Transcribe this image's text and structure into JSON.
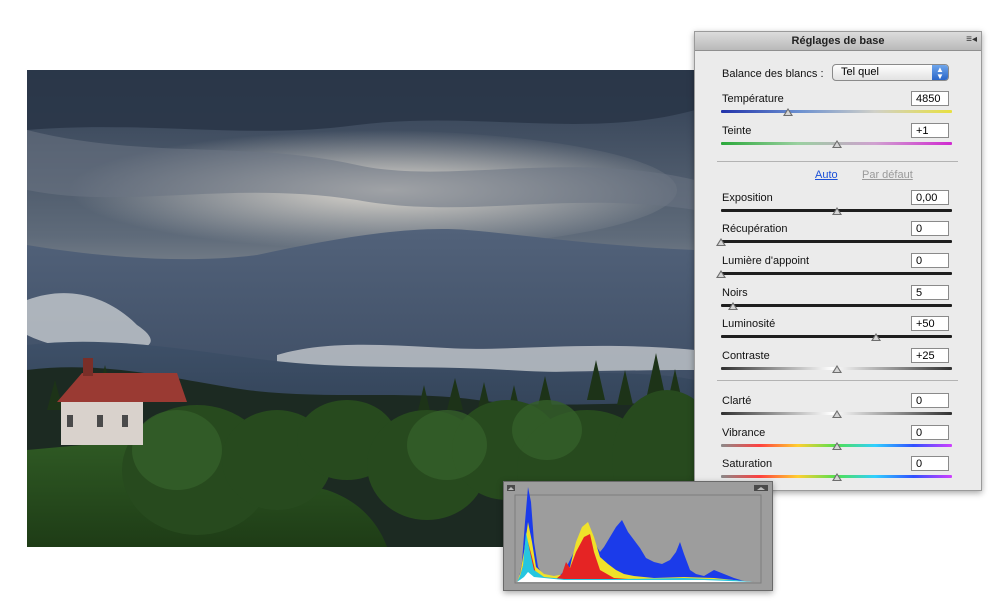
{
  "panel": {
    "title": "Réglages de base",
    "menu_icon": "menu-icon",
    "white_balance": {
      "label": "Balance des blancs :",
      "value": "Tel quel",
      "options": [
        "Tel quel"
      ]
    },
    "auto_label": "Auto",
    "default_label": "Par défaut",
    "sliders": [
      {
        "name": "temperature",
        "label": "Température",
        "value": "4850",
        "position": 0.29,
        "track": "temperature"
      },
      {
        "name": "tint",
        "label": "Teinte",
        "value": "+1",
        "position": 0.5,
        "track": "tint"
      },
      {
        "name": "exposure",
        "label": "Exposition",
        "value": "0,00",
        "position": 0.5,
        "track": "dark"
      },
      {
        "name": "recovery",
        "label": "Récupération",
        "value": "0",
        "position": 0.0,
        "track": "dark"
      },
      {
        "name": "fill-light",
        "label": "Lumière d'appoint",
        "value": "0",
        "position": 0.0,
        "track": "dark"
      },
      {
        "name": "blacks",
        "label": "Noirs",
        "value": "5",
        "position": 0.05,
        "track": "dark"
      },
      {
        "name": "brightness",
        "label": "Luminosité",
        "value": "+50",
        "position": 0.67,
        "track": "dark"
      },
      {
        "name": "contrast",
        "label": "Contraste",
        "value": "+25",
        "position": 0.5,
        "track": "contrast"
      },
      {
        "name": "clarity",
        "label": "Clarté",
        "value": "0",
        "position": 0.5,
        "track": "contrast"
      },
      {
        "name": "vibrance",
        "label": "Vibrance",
        "value": "0",
        "position": 0.5,
        "track": "spectrum"
      },
      {
        "name": "saturation",
        "label": "Saturation",
        "value": "0",
        "position": 0.5,
        "track": "spectrum"
      }
    ]
  },
  "histogram": {
    "shadow_clip_icon": "shadow-clipping-icon",
    "highlight_clip_icon": "highlight-clipping-icon"
  },
  "colors": {
    "panel_bg": "#ebebeb",
    "histogram_bg": "#9d9d9d",
    "link_blue": "#1a4fd8",
    "select_accent": "#2a66c8"
  }
}
